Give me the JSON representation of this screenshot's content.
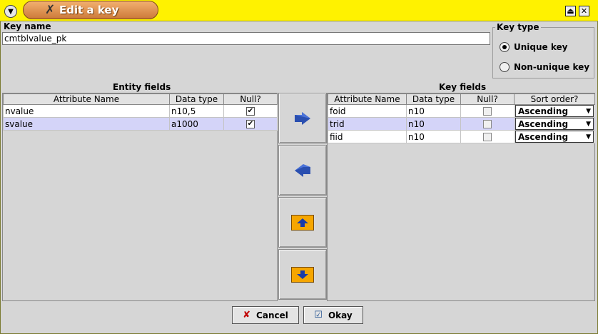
{
  "window": {
    "title": "Edit a key",
    "menu_icon": "chevron-down-icon",
    "title_icon": "tools-icon",
    "max_symbol": "⏏",
    "close_symbol": "✕"
  },
  "key_name": {
    "label": "Key name",
    "value": "cmtblvalue_pk"
  },
  "key_type": {
    "legend": "Key type",
    "options": [
      {
        "label": "Unique key",
        "selected": true
      },
      {
        "label": "Non-unique key",
        "selected": false
      }
    ]
  },
  "entity_fields": {
    "title": "Entity fields",
    "columns": [
      "Attribute Name",
      "Data type",
      "Null?"
    ],
    "rows": [
      {
        "name": "nvalue",
        "type": "n10,5",
        "null": true,
        "selected": false
      },
      {
        "name": "svalue",
        "type": "a1000",
        "null": true,
        "selected": true
      }
    ]
  },
  "key_fields": {
    "title": "Key fields",
    "columns": [
      "Attribute Name",
      "Data type",
      "Null?",
      "Sort order?"
    ],
    "rows": [
      {
        "name": "foid",
        "type": "n10",
        "null": false,
        "sort": "Ascending",
        "selected": false
      },
      {
        "name": "trid",
        "type": "n10",
        "null": false,
        "sort": "Ascending",
        "selected": true
      },
      {
        "name": "fiid",
        "type": "n10",
        "null": false,
        "sort": "Ascending",
        "selected": false
      }
    ]
  },
  "buttons": {
    "cancel": "Cancel",
    "okay": "Okay"
  },
  "colors": {
    "titlebar": "#fff200",
    "arrow_blue": "#2a4fb0",
    "arrow_box": "#f6a600",
    "selection": "#d4d4f8"
  }
}
